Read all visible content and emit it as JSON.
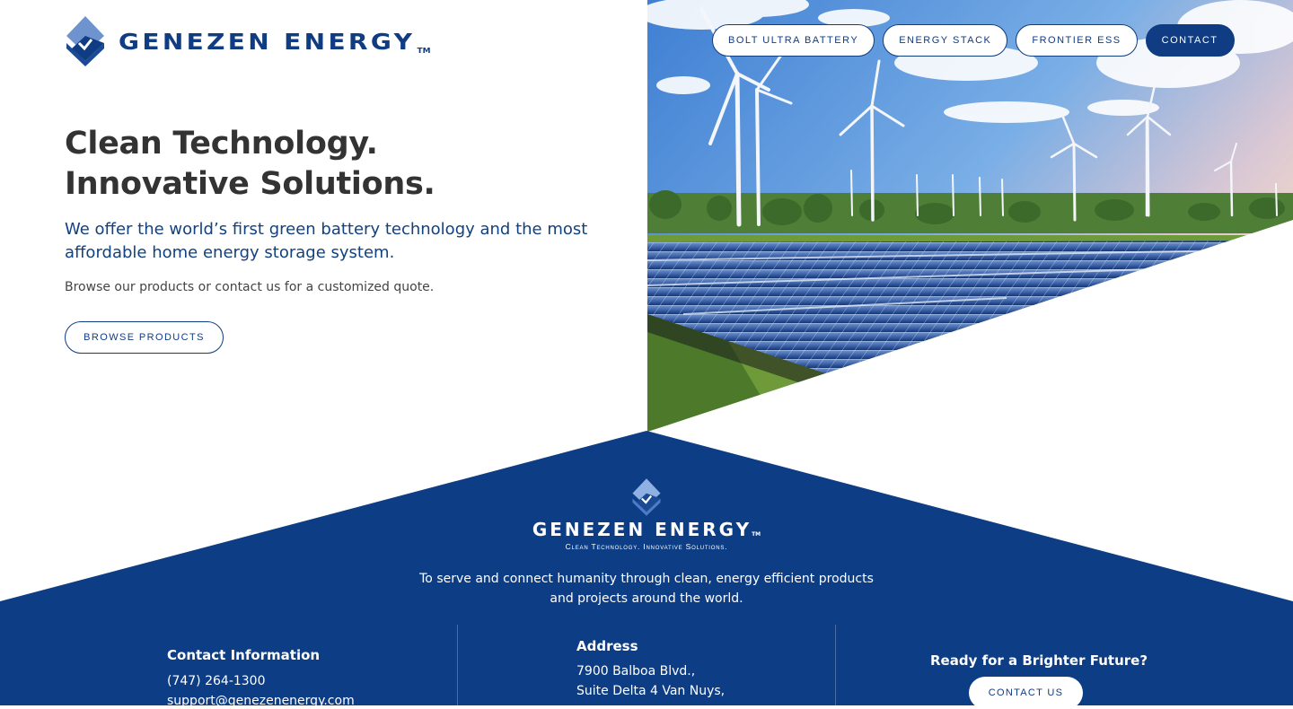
{
  "brand": {
    "name": "GENEZEN ENERGY",
    "tm": "TM",
    "tagline": "Clean Technology. Innovative Solutions.",
    "colors": {
      "primary": "#0f3c82",
      "light": "#5b86c7",
      "dark": "#0a2d66"
    }
  },
  "nav": {
    "items": [
      {
        "label": "BOLT ULTRA BATTERY"
      },
      {
        "label": "ENERGY STACK"
      },
      {
        "label": "FRONTIER ESS"
      },
      {
        "label": "CONTACT"
      }
    ]
  },
  "hero": {
    "title_line1": "Clean Technology.",
    "title_line2": "Innovative Solutions.",
    "lead": "We offer the world’s first green battery technology and the most affordable home energy storage system.",
    "sub": "Browse our products or contact us for a customized quote.",
    "button": "BROWSE PRODUCTS",
    "image": "wind-turbines-and-solar-panels-photo"
  },
  "footer": {
    "mission_line1": "To serve and connect humanity through clean, energy efficient products",
    "mission_line2": "and projects around the world.",
    "contact": {
      "title": "Contact Information",
      "phone": "(747) 264-1300",
      "email": "support@genezenenergy.com"
    },
    "address": {
      "title": "Address",
      "line1": "7900 Balboa Blvd.,",
      "line2": "Suite Delta 4 Van Nuys,"
    },
    "cta": {
      "title": "Ready for a Brighter Future?",
      "button": "CONTACT US"
    },
    "colors": {
      "background": "#0d3d84"
    }
  }
}
